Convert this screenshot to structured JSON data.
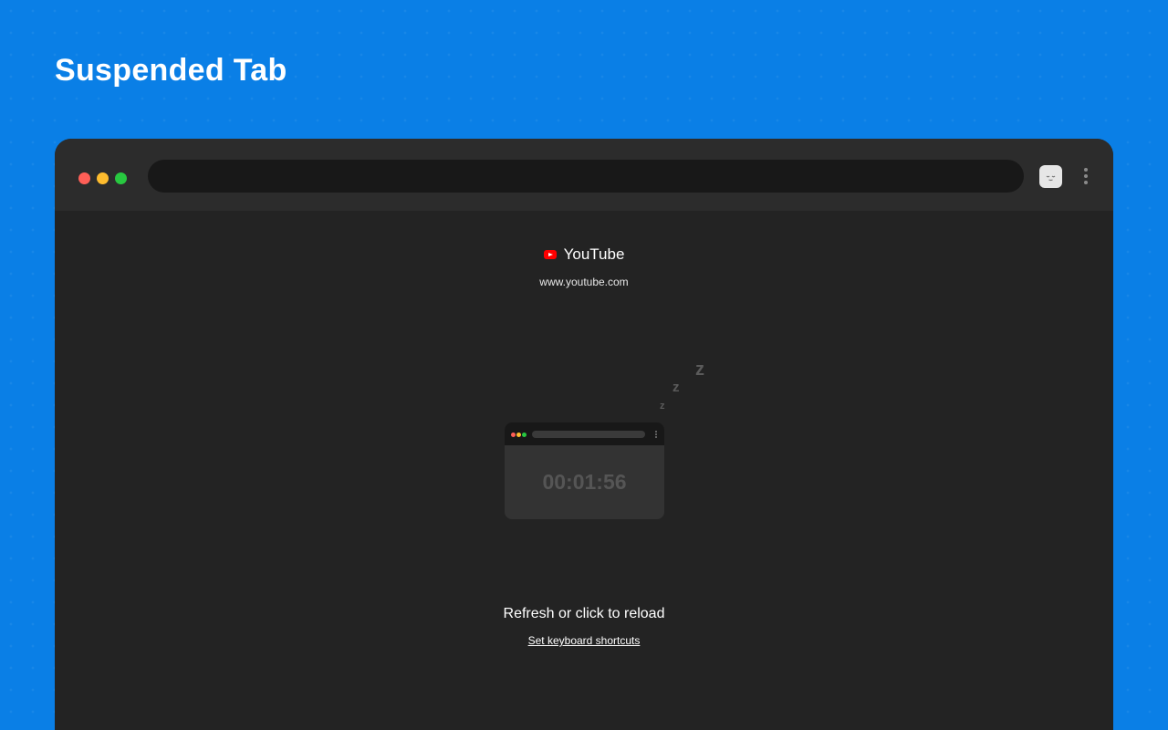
{
  "page": {
    "heading": "Suspended Tab",
    "background_color": "#0a7fe6"
  },
  "browser": {
    "window_buttons": [
      "close",
      "minimize",
      "maximize"
    ],
    "address_value": "",
    "extension_icon": "sleeping-face-icon",
    "menu_icon": "kebab-menu-icon"
  },
  "suspended_page": {
    "site_name": "YouTube",
    "site_icon": "youtube-icon",
    "site_url": "www.youtube.com",
    "timer": "00:01:56",
    "zzz": [
      "z",
      "z",
      "z"
    ],
    "reload_message": "Refresh or click to reload",
    "shortcuts_link": "Set keyboard shortcuts"
  },
  "colors": {
    "window_bg": "#232323",
    "toolbar_bg": "#2c2c2c",
    "close": "#ff5f57",
    "minimize": "#febc2e",
    "maximize": "#28c840",
    "youtube_red": "#ff0000"
  }
}
